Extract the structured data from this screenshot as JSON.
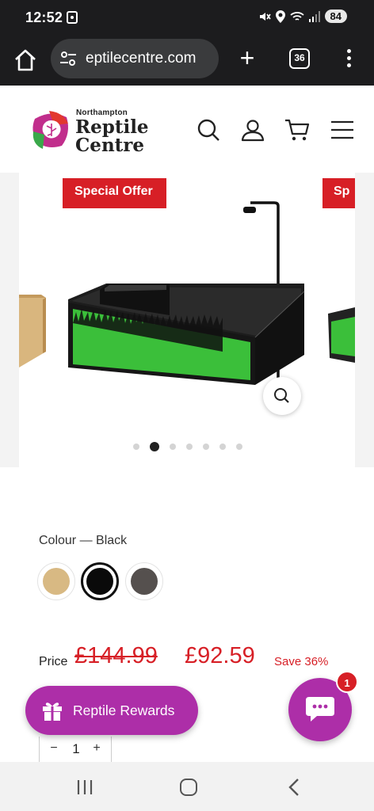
{
  "status_bar": {
    "time": "12:52",
    "battery": "84"
  },
  "browser": {
    "url": "eptilecentre.com",
    "tab_count": "36",
    "new_tab_symbol": "+"
  },
  "site": {
    "logo_small": "Northampton",
    "logo_line1": "Reptile",
    "logo_line2": "Centre",
    "header_icons": [
      "search-icon",
      "account-icon",
      "cart-icon",
      "hamburger-menu-icon"
    ]
  },
  "gallery": {
    "badge_main": "Special Offer",
    "badge_next": "Sp",
    "active_slide": 2,
    "slide_count": 7,
    "accent_green": "#3bbf3a"
  },
  "options": {
    "colour_label": "Colour — Black",
    "swatches": [
      {
        "name": "Oak",
        "color": "#d8b983",
        "selected": false
      },
      {
        "name": "Black",
        "color": "#0a0a0a",
        "selected": true
      },
      {
        "name": "Grey",
        "color": "#55504e",
        "selected": false
      }
    ]
  },
  "price": {
    "label": "Price",
    "old": "£144.99",
    "new": "£92.59",
    "save": "Save 36%",
    "color": "#d71f26"
  },
  "rewards": {
    "label": "Reptile Rewards",
    "color": "#ad2ea8"
  },
  "chat": {
    "unread": "1"
  },
  "quantity": {
    "minus": "−",
    "value": "1",
    "plus": "+"
  }
}
